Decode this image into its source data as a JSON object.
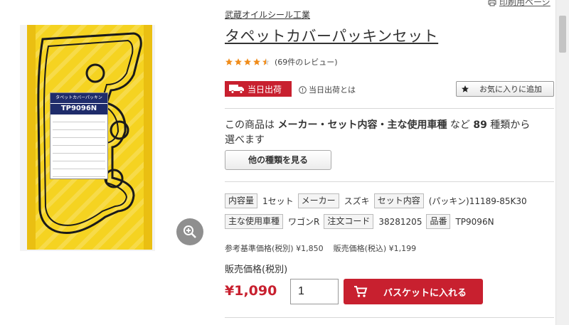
{
  "page": {
    "print_link": "印刷用ページ"
  },
  "product": {
    "brand": "武蔵オイルシール工業",
    "title": "タペットカバーパッキンセット",
    "rating_value": 4.5,
    "review_count_text": "(69件のレビュー)",
    "image": {
      "package_label_head": "タペットカバーパッキン",
      "package_code": "TP9096N"
    }
  },
  "shipping": {
    "badge_label": "当日出荷",
    "help_text": "当日出荷とは"
  },
  "favorite": {
    "label": "お気に入りに追加"
  },
  "variants": {
    "text_prefix": "この商品は",
    "text_bold": "メーカー・セット内容・主な使用車種",
    "text_mid": "など",
    "count": "89",
    "text_suffix": "種類から選べます",
    "button_label": "他の種類を見る"
  },
  "specs": {
    "row1": [
      {
        "label": "内容量",
        "value": "1セット"
      },
      {
        "label": "メーカー",
        "value": "スズキ"
      },
      {
        "label": "セット内容",
        "value": "(パッキン)11189-85K30"
      }
    ],
    "row2": [
      {
        "label": "主な使用車種",
        "value": "ワゴンR"
      },
      {
        "label": "注文コード",
        "value": "38281205"
      },
      {
        "label": "品番",
        "value": "TP9096N"
      }
    ]
  },
  "pricing": {
    "reference_price": "参考基準価格(税別) ¥1,850",
    "sale_price_tax_incl": "販売価格(税込) ¥1,199",
    "price_label": "販売価格(税別)",
    "price": "¥1,090",
    "quantity": "1",
    "cart_button_label": "バスケットに入れる"
  },
  "colors": {
    "accent_red": "#c8202f",
    "star_orange": "#f08c1a",
    "package_yellow": "#f5d321"
  }
}
